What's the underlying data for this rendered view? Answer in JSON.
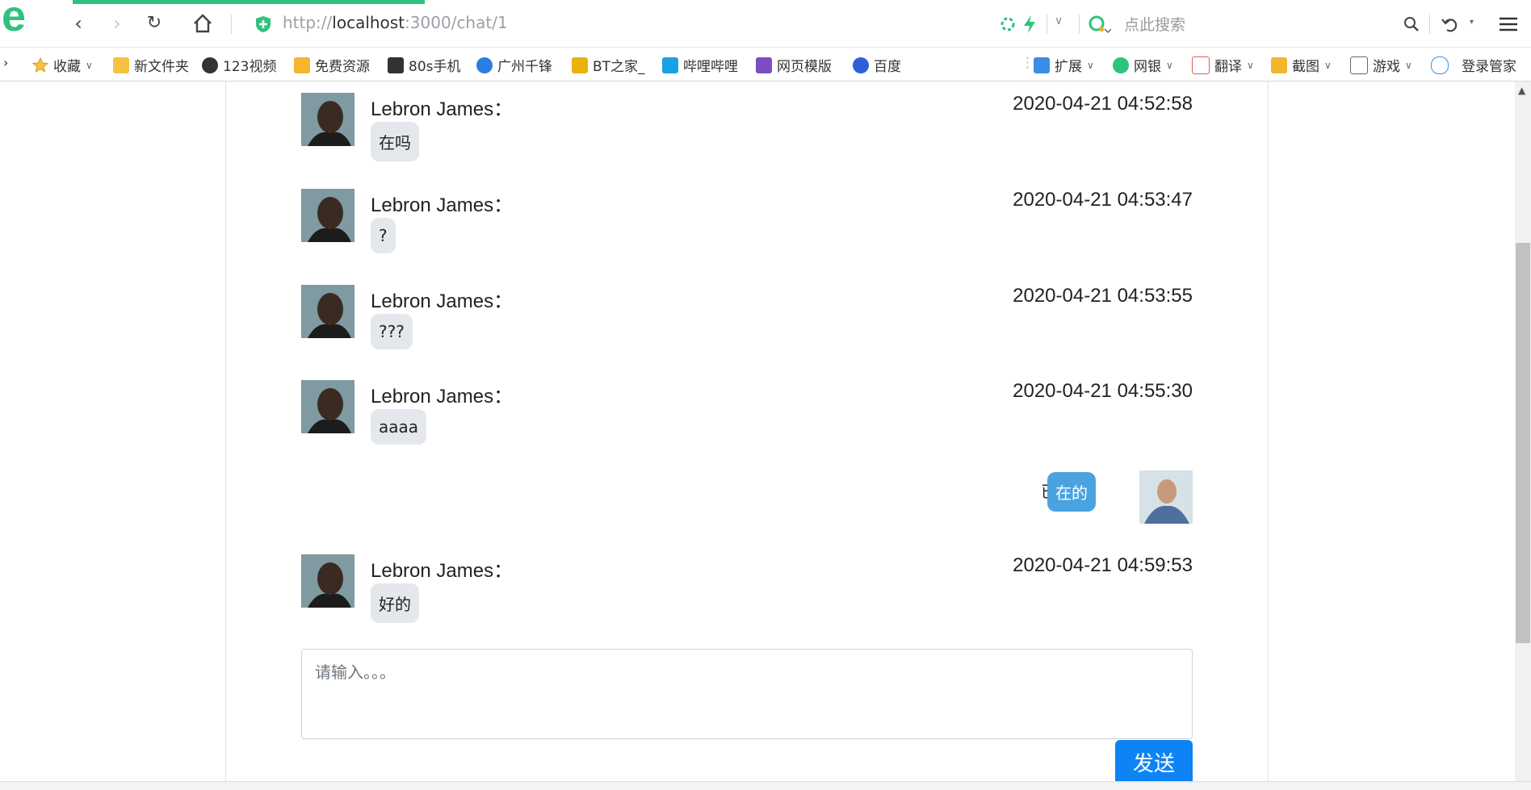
{
  "browser": {
    "url_prefix": "http://",
    "url_host": "localhost",
    "url_rest": ":3000/chat/1",
    "search_placeholder": "点此搜索",
    "accent_color": "#2ec27e"
  },
  "bookmarks": [
    {
      "label": "收藏",
      "icon": "star-icon"
    },
    {
      "label": "新文件夹",
      "icon": "folder-icon"
    },
    {
      "label": "123视频",
      "icon": "video-icon"
    },
    {
      "label": "免费资源",
      "icon": "trophy-icon"
    },
    {
      "label": "80s手机",
      "icon": "film-icon"
    },
    {
      "label": "广州千锋",
      "icon": "q-logo-icon"
    },
    {
      "label": "BT之家_",
      "icon": "bt-icon"
    },
    {
      "label": "哔哩哔哩",
      "icon": "bilibili-icon"
    },
    {
      "label": "网页模版",
      "icon": "template-icon"
    },
    {
      "label": "百度",
      "icon": "baidu-paw-icon"
    }
  ],
  "tools": [
    {
      "label": "扩展",
      "icon": "extension-icon"
    },
    {
      "label": "网银",
      "icon": "bank-icon"
    },
    {
      "label": "翻译",
      "icon": "translate-icon"
    },
    {
      "label": "截图",
      "icon": "screenshot-icon"
    },
    {
      "label": "游戏",
      "icon": "gamepad-icon"
    },
    {
      "label": "登录管家",
      "icon": "login-icon"
    }
  ],
  "chat": {
    "messages": [
      {
        "sender": "Lebron James：",
        "time": "2020-04-21 04:52:58",
        "text": "在吗"
      },
      {
        "sender": "Lebron James：",
        "time": "2020-04-21 04:53:47",
        "text": "?"
      },
      {
        "sender": "Lebron James：",
        "time": "2020-04-21 04:53:55",
        "text": "???"
      },
      {
        "sender": "Lebron James：",
        "time": "2020-04-21 04:55:30",
        "text": "aaaa"
      }
    ],
    "mine": {
      "read_status": "已读",
      "text": "在的"
    },
    "last_message": {
      "sender": "Lebron James：",
      "time": "2020-04-21 04:59:53",
      "text": "好的"
    },
    "input_placeholder": "请输入。。。",
    "send_label": "发送",
    "bubble_color": "#e4e8ec",
    "my_bubble_color": "#4aa3df",
    "send_color": "#0d83f5"
  }
}
